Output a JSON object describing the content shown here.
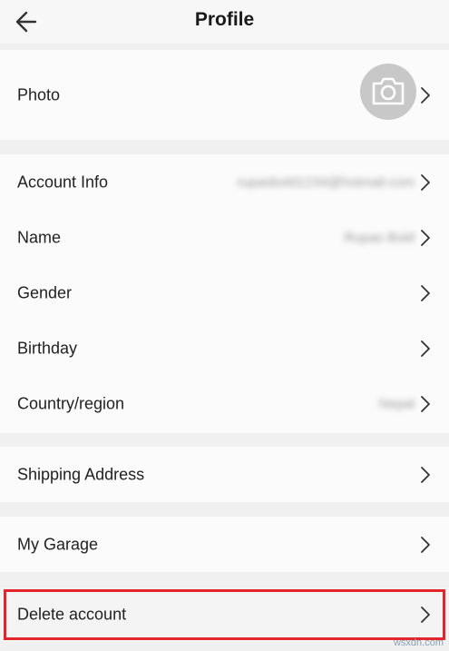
{
  "header": {
    "title": "Profile"
  },
  "rows": {
    "photo": "Photo",
    "account_info": "Account Info",
    "account_info_value": "rupasbold1234@hotmail.com",
    "name": "Name",
    "name_value": "Rupas Bold",
    "gender": "Gender",
    "birthday": "Birthday",
    "country": "Country/region",
    "country_value": "Nepal",
    "shipping": "Shipping Address",
    "garage": "My Garage",
    "delete": "Delete account"
  },
  "watermark": "wsxdn.com",
  "colors": {
    "highlight": "#e2262c",
    "background": "#f0f0f0",
    "row_background": "#fbfbfb"
  },
  "icons": {
    "back": "back-arrow-icon",
    "camera": "camera-icon",
    "chevron": "chevron-right-icon"
  }
}
